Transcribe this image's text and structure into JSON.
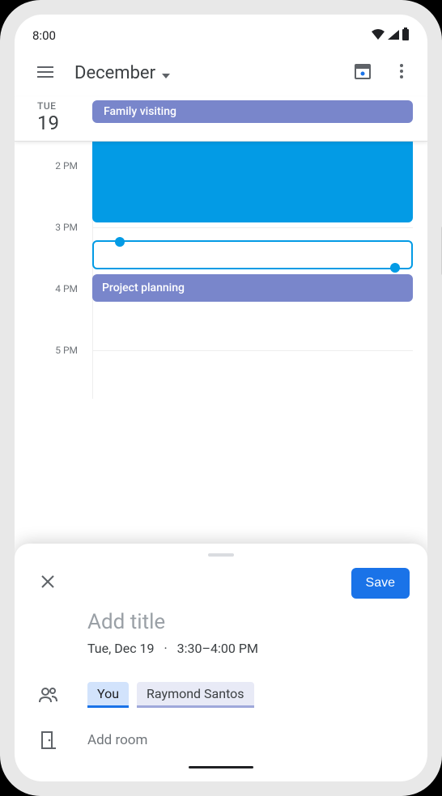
{
  "status": {
    "time": "8:00"
  },
  "header": {
    "month": "December"
  },
  "day": {
    "weekday": "TUE",
    "number": "19"
  },
  "allday_event": {
    "title": "Family visiting"
  },
  "time_slots": [
    "",
    "2 PM",
    "3 PM",
    "4 PM",
    "5 PM"
  ],
  "events": {
    "blue": "",
    "project": "Project planning"
  },
  "sheet": {
    "save_label": "Save",
    "title_placeholder": "Add title",
    "date_text": "Tue, Dec 19",
    "time_text": "3:30–4:00 PM",
    "you_chip": "You",
    "guest_chip": "Raymond Santos",
    "add_room": "Add room"
  }
}
